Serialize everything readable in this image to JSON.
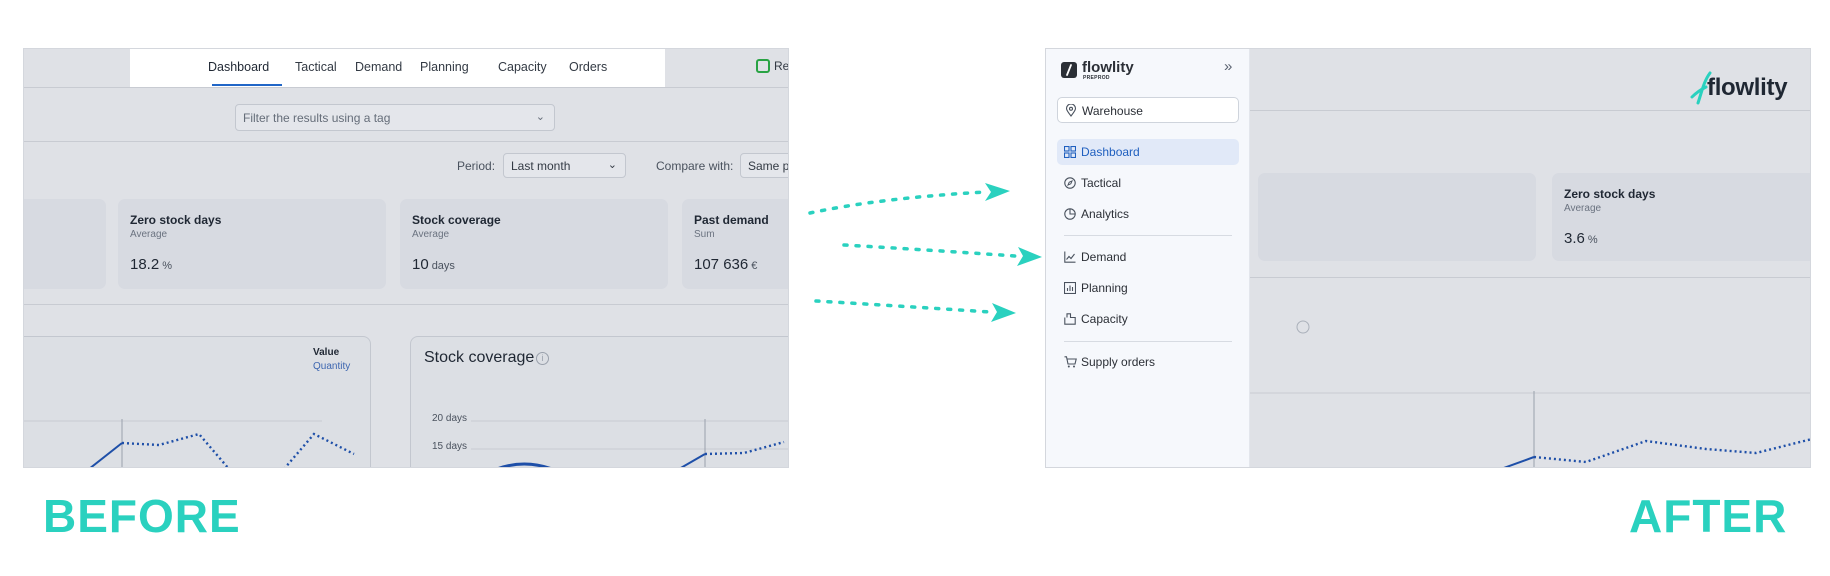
{
  "colors": {
    "accent": "#2ad1bf",
    "active_nav": "#1f5fbf",
    "line_series": "#1e4fa8"
  },
  "labels": {
    "before": "BEFORE",
    "after": "AFTER"
  },
  "before": {
    "topnav": {
      "tabs": [
        "Dashboard",
        "Tactical",
        "Demand",
        "Planning",
        "Capacity",
        "Orders"
      ],
      "active": "Dashboard"
    },
    "checkbox_label": "Re",
    "filter_placeholder": "Filter the results using a tag",
    "period": {
      "label": "Period:",
      "value": "Last month"
    },
    "compare": {
      "label": "Compare with:",
      "value": "Same pe"
    },
    "kpis": [
      {
        "title": "Zero stock days",
        "sub": "Average",
        "value": "18.2",
        "unit": "%"
      },
      {
        "title": "Stock coverage",
        "sub": "Average",
        "value": "10",
        "unit": "days"
      },
      {
        "title": "Past demand",
        "sub": "Sum",
        "value": "107 636",
        "unit": "€"
      }
    ],
    "legend": {
      "value": "Value",
      "quantity": "Quantity"
    },
    "stock_coverage_title": "Stock coverage",
    "info_icon": "i",
    "yticks": [
      "20 days",
      "15 days"
    ]
  },
  "after": {
    "sidebar": {
      "logo": "flowlity",
      "logo_sub": "PREPROD",
      "collapse_icon": "»",
      "warehouse": "Warehouse",
      "nav_groups": [
        [
          {
            "label": "Dashboard",
            "icon": "dashboard-icon",
            "active": true
          },
          {
            "label": "Tactical",
            "icon": "compass-icon",
            "active": false
          },
          {
            "label": "Analytics",
            "icon": "pie-icon",
            "active": false
          }
        ],
        [
          {
            "label": "Demand",
            "icon": "line-chart-icon",
            "active": false
          },
          {
            "label": "Planning",
            "icon": "bar-chart-icon",
            "active": false
          },
          {
            "label": "Capacity",
            "icon": "capacity-icon",
            "active": false
          }
        ],
        [
          {
            "label": "Supply orders",
            "icon": "cart-icon",
            "active": false
          }
        ]
      ]
    },
    "brand": "flowlity",
    "kpi": {
      "title": "Zero stock days",
      "sub": "Average",
      "value": "3.6",
      "unit": "%"
    }
  }
}
